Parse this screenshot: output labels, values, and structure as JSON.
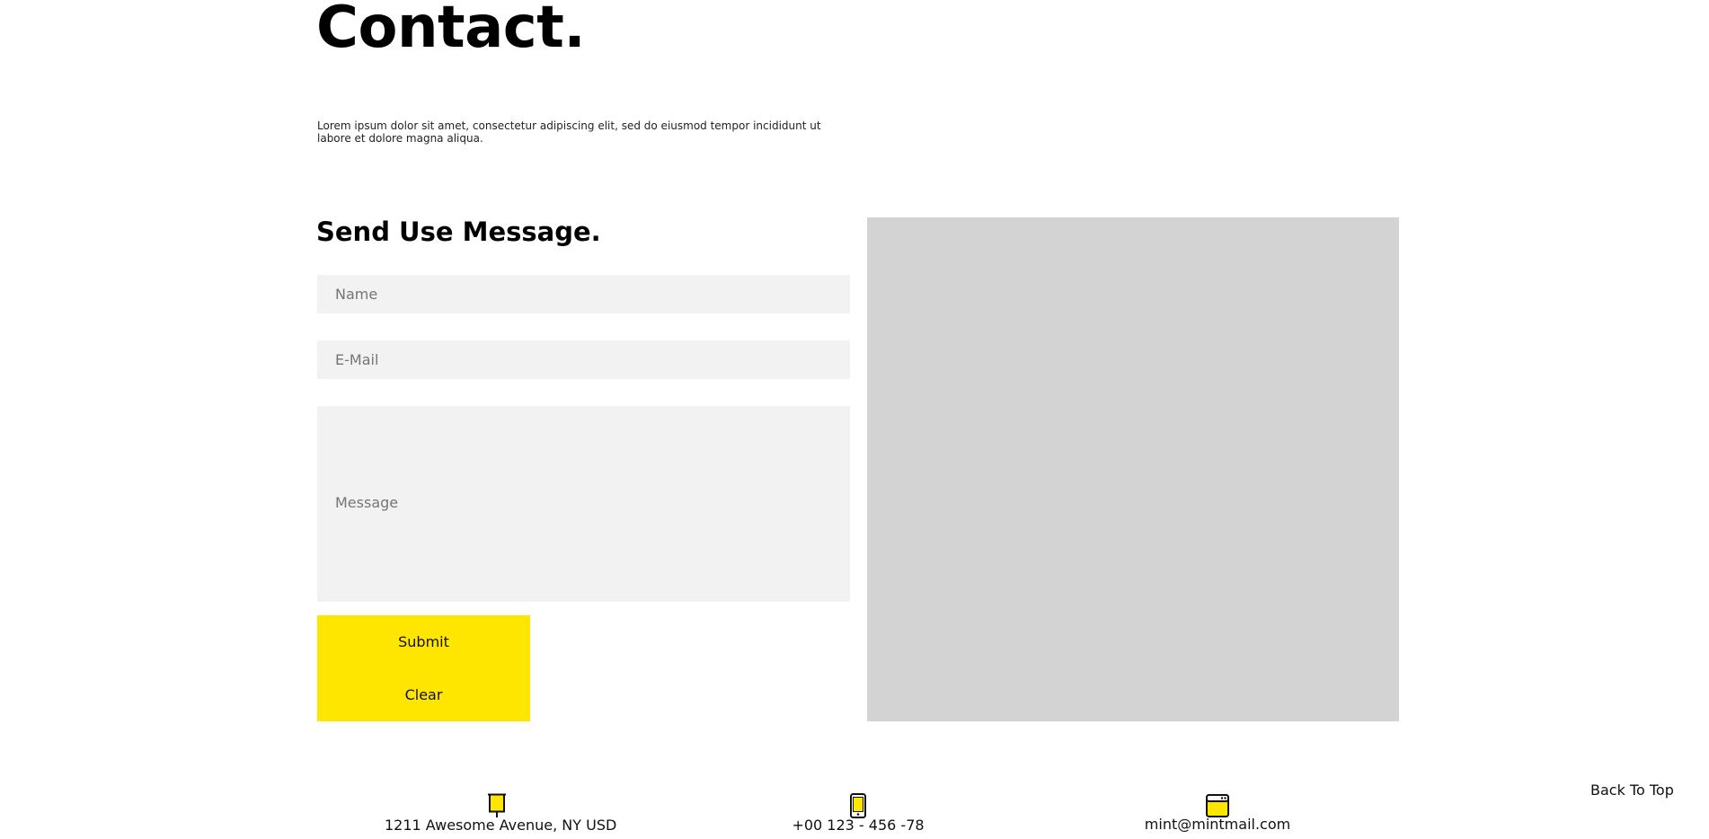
{
  "header": {
    "title": "Contact.",
    "intro": "Lorem ipsum dolor sit amet, consectetur adipiscing elit, sed do eiusmod tempor incididunt ut labore et dolore magna aliqua."
  },
  "form": {
    "heading": "Send Use Message.",
    "name_placeholder": "Name",
    "email_placeholder": "E-Mail",
    "message_placeholder": "Message",
    "submit_label": "Submit",
    "clear_label": "Clear"
  },
  "contact_info": {
    "address": "1211 Awesome Avenue, NY USD",
    "phone": "+00 123 - 456 -78",
    "email": "mint@mintmail.com",
    "address_icon": "signpost-icon",
    "phone_icon": "mobile-phone-icon",
    "email_icon": "browser-window-icon"
  },
  "footer": {
    "back_to_top": "Back To Top"
  },
  "colors": {
    "accent": "#ffe600",
    "field_bg": "#f2f2f2",
    "map_placeholder": "#d3d3d3"
  }
}
